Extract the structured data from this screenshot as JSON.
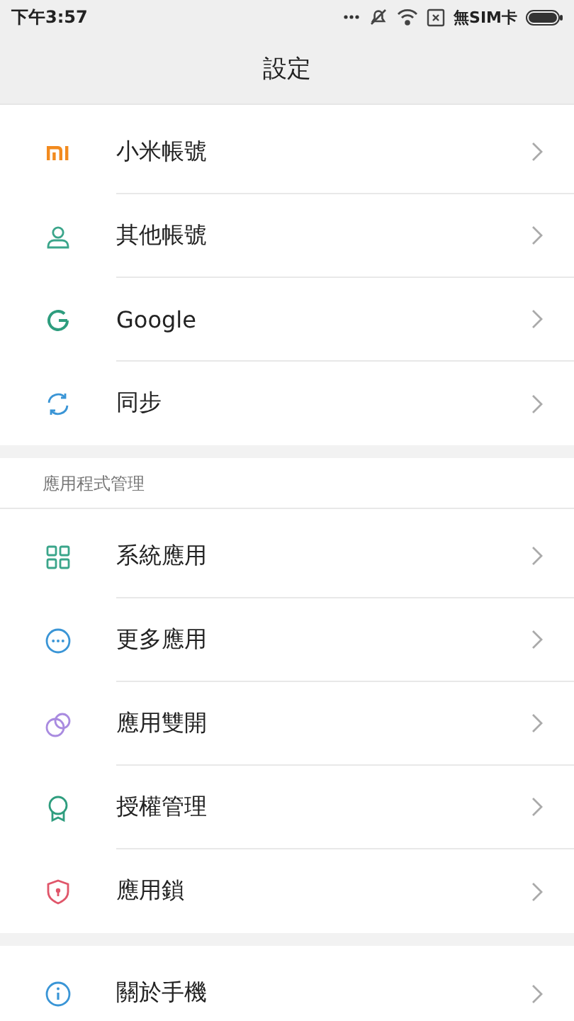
{
  "status_bar": {
    "time": "下午3:57",
    "carrier": "無SIM卡"
  },
  "title": "設定",
  "sections": [
    {
      "items": [
        {
          "kind": "mi",
          "label": "小米帳號"
        },
        {
          "kind": "person",
          "label": "其他帳號"
        },
        {
          "kind": "google",
          "label": "Google"
        },
        {
          "kind": "sync",
          "label": "同步"
        }
      ]
    },
    {
      "header": "應用程式管理",
      "items": [
        {
          "kind": "grid",
          "label": "系統應用"
        },
        {
          "kind": "more",
          "label": "更多應用"
        },
        {
          "kind": "dual",
          "label": "應用雙開"
        },
        {
          "kind": "badge",
          "label": "授權管理"
        },
        {
          "kind": "lock",
          "label": "應用鎖"
        }
      ]
    },
    {
      "items": [
        {
          "kind": "info",
          "label": "關於手機"
        }
      ]
    }
  ]
}
